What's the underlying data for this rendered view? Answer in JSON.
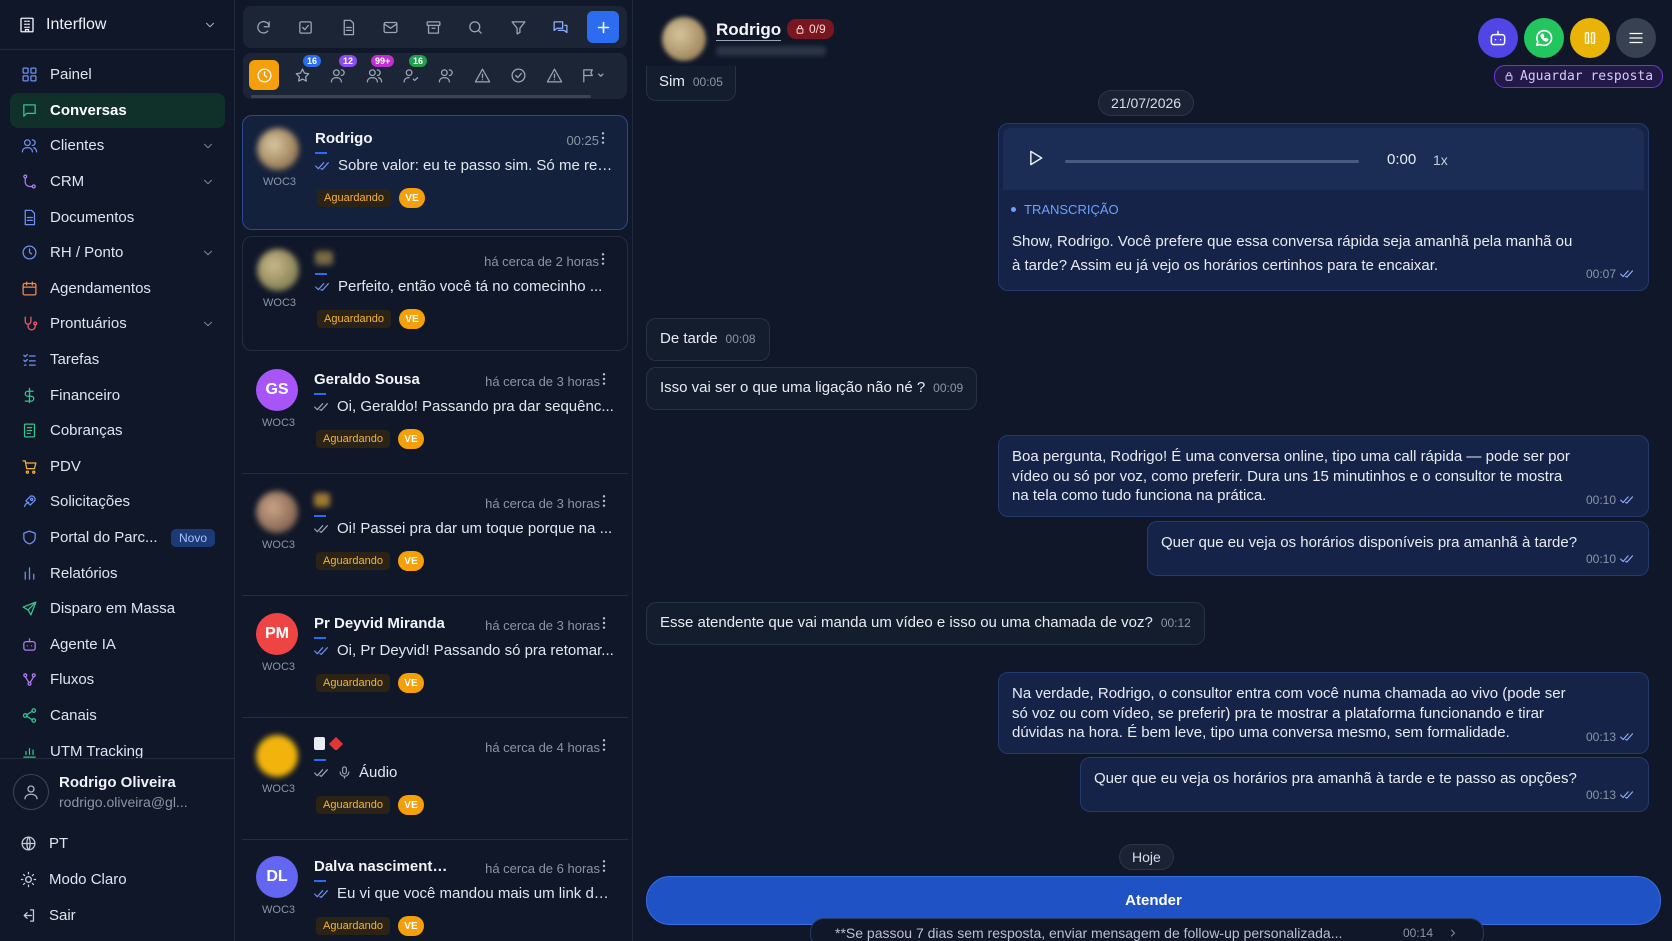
{
  "sidebar": {
    "brand": "Interflow",
    "items": [
      {
        "label": "Painel"
      },
      {
        "label": "Conversas"
      },
      {
        "label": "Clientes"
      },
      {
        "label": "CRM"
      },
      {
        "label": "Documentos"
      },
      {
        "label": "RH / Ponto"
      },
      {
        "label": "Agendamentos"
      },
      {
        "label": "Prontuários"
      },
      {
        "label": "Tarefas"
      },
      {
        "label": "Financeiro"
      },
      {
        "label": "Cobranças"
      },
      {
        "label": "PDV"
      },
      {
        "label": "Solicitações"
      },
      {
        "label": "Portal do Parc...",
        "badge": "Novo"
      },
      {
        "label": "Relatórios"
      },
      {
        "label": "Disparo em Massa"
      },
      {
        "label": "Agente IA"
      },
      {
        "label": "Fluxos"
      },
      {
        "label": "Canais"
      },
      {
        "label": "UTM Tracking"
      }
    ],
    "user": {
      "name": "Rodrigo Oliveira",
      "email": "rodrigo.oliveira@gl..."
    },
    "footer": {
      "language": "PT",
      "theme": "Modo Claro",
      "logout": "Sair"
    }
  },
  "filters": {
    "counts": [
      "16",
      "12",
      "99+",
      "16"
    ]
  },
  "conversations": [
    {
      "name": "Rodrigo",
      "time": "00:25",
      "message": "Sobre valor: eu te passo sim. Só me res...",
      "channel": "WOC3",
      "status": "Aguardando",
      "tag": "VE"
    },
    {
      "name": "",
      "time": "há cerca de 2 horas",
      "message": "Perfeito, então você tá no comecinho ...",
      "channel": "WOC3",
      "status": "Aguardando",
      "tag": "VE"
    },
    {
      "name": "Geraldo Sousa",
      "initials": "GS",
      "time": "há cerca de 3 horas",
      "message": "Oi, Geraldo! Passando pra dar sequênc...",
      "channel": "WOC3",
      "status": "Aguardando",
      "tag": "VE"
    },
    {
      "name": "",
      "time": "há cerca de 3 horas",
      "message": "Oi! Passei pra dar um toque porque na ...",
      "channel": "WOC3",
      "status": "Aguardando",
      "tag": "VE"
    },
    {
      "name": "Pr Deyvid Miranda",
      "initials": "PM",
      "time": "há cerca de 3 horas",
      "message": "Oi, Pr Deyvid! Passando só pra retomar...",
      "channel": "WOC3",
      "status": "Aguardando",
      "tag": "VE"
    },
    {
      "name": "",
      "time": "há cerca de 4 horas",
      "message": "Áudio",
      "channel": "WOC3",
      "status": "Aguardando",
      "tag": "VE"
    },
    {
      "name": "Dalva nascimento ...",
      "initials": "DL",
      "time": "há cerca de 6 horas",
      "message": "Eu vi que você mandou mais um link do...",
      "channel": "WOC3",
      "status": "Aguardando",
      "tag": "VE"
    }
  ],
  "chat": {
    "contact_name": "Rodrigo",
    "counter": "0/9",
    "await_label": "Aguardar resposta",
    "date_pill": "21/07/2026",
    "today_pill": "Hoje",
    "audio": {
      "time": "0:00",
      "speed": "1x",
      "transcription_label": "TRANSCRIÇÃO"
    },
    "messages": [
      {
        "dir": "in",
        "text": "Sim",
        "time": "00:05"
      },
      {
        "dir": "out",
        "text": "Show, Rodrigo. Você prefere que essa conversa rápida seja amanhã pela manhã ou à tarde? Assim eu já vejo os horários certinhos para te encaixar.",
        "time": "00:07"
      },
      {
        "dir": "in",
        "text": "De tarde",
        "time": "00:08"
      },
      {
        "dir": "in",
        "text": "Isso vai ser o que uma ligação não né ?",
        "time": "00:09"
      },
      {
        "dir": "out",
        "text": "Boa pergunta, Rodrigo! É uma conversa online, tipo uma call rápida — pode ser por vídeo ou só por voz, como preferir. Dura uns 15 minutinhos e o consultor te mostra na tela como tudo funciona na prática.",
        "time": "00:10"
      },
      {
        "dir": "out",
        "text": "Quer que eu veja os horários disponíveis pra amanhã à tarde?",
        "time": "00:10"
      },
      {
        "dir": "in",
        "text": "Esse atendente que vai manda um vídeo e isso ou uma chamada de voz?",
        "time": "00:12"
      },
      {
        "dir": "out",
        "text": "Na verdade, Rodrigo, o consultor entra com você numa chamada ao vivo (pode ser só voz ou com vídeo, se preferir) pra te mostrar a plataforma funcionando e tirar dúvidas na hora. É bem leve, tipo uma conversa mesmo, sem formalidade.",
        "time": "00:13"
      },
      {
        "dir": "out",
        "text": "Quer que eu veja os horários pra amanhã à tarde e te passo as opções?",
        "time": "00:13"
      }
    ],
    "attend_label": "Atender",
    "tip": {
      "text": "**Se passou 7 dias sem resposta, enviar mensagem de follow-up personalizada...",
      "time": "00:14"
    }
  },
  "colors": {
    "accent": "#2b6cf0",
    "warning": "#f59f0a",
    "whatsapp": "#22c55e",
    "bot": "#4f46e5"
  }
}
